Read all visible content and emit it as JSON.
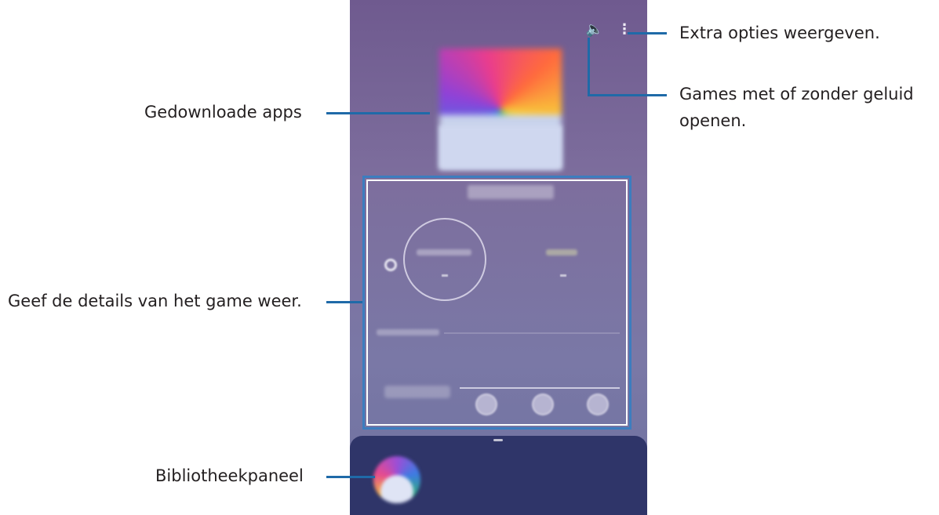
{
  "callouts": {
    "more_options": "Extra opties weergeven.",
    "sound_line1": "Games met of zonder geluid",
    "sound_line2": "openen.",
    "downloaded_apps": "Gedownloade apps",
    "game_details": "Geef de details van het game weer.",
    "library_panel": "Bibliotheekpaneel"
  },
  "icons": {
    "sound": "speaker-icon",
    "more": "more-options-icon"
  },
  "colors": {
    "callout_line": "#1f6aa8",
    "highlight_box": "#3c7dbf",
    "library_panel": "#2f3569"
  }
}
